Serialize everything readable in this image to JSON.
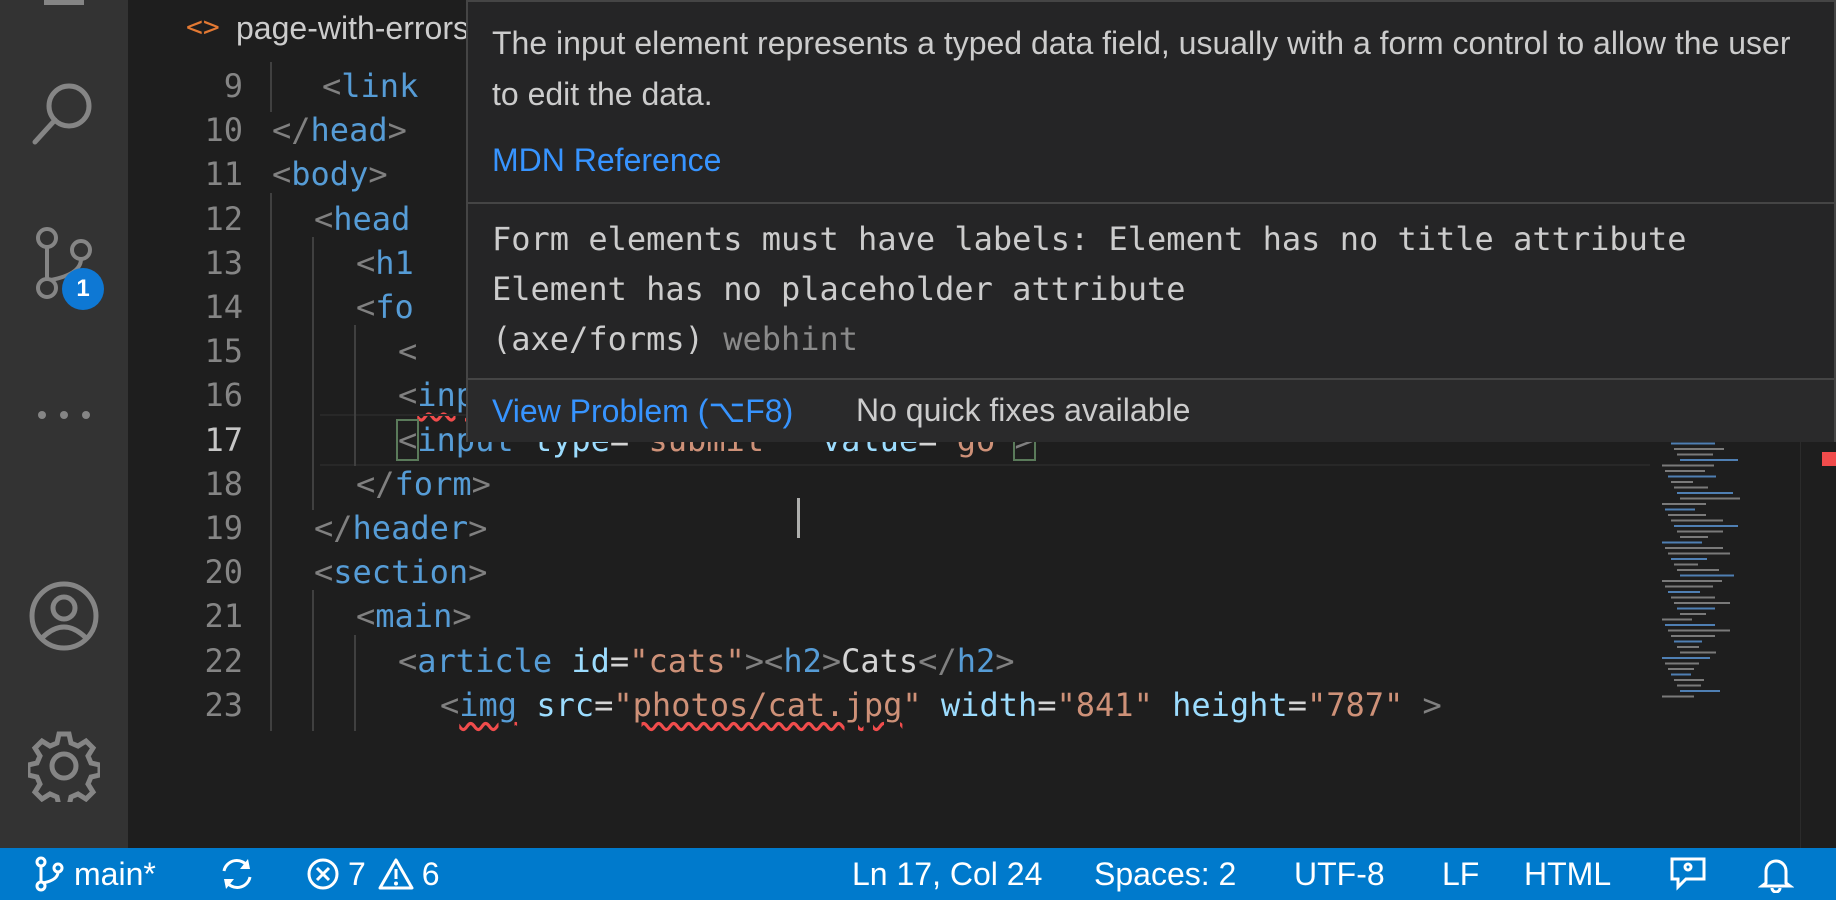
{
  "activity_bar": {
    "icons": [
      "menu-icon",
      "search-icon",
      "source-control-icon",
      "more-icon",
      "account-icon",
      "settings-gear-icon"
    ],
    "source_control_badge": "1"
  },
  "tab": {
    "label": "page-with-errors.html",
    "icon": "html-file-icon",
    "icon_glyph": "<>"
  },
  "editor": {
    "lines": [
      {
        "n": "9"
      },
      {
        "n": "10"
      },
      {
        "n": "11"
      },
      {
        "n": "12"
      },
      {
        "n": "13"
      },
      {
        "n": "14"
      },
      {
        "n": "15"
      },
      {
        "n": "16"
      },
      {
        "n": "17"
      },
      {
        "n": "18"
      },
      {
        "n": "19"
      },
      {
        "n": "20"
      },
      {
        "n": "21"
      },
      {
        "n": "22"
      },
      {
        "n": "23"
      }
    ]
  },
  "hover": {
    "description": "The input element represents a typed data field, usually with a form control to allow the user to edit the data.",
    "mdn_link": "MDN Reference",
    "problem_line1": "Form elements must have labels: Element has no title attribute",
    "problem_line2": "Element has no placeholder attribute",
    "problem_code": "(axe/forms)",
    "problem_source": "webhint",
    "view_problem": "View Problem (⌥F8)",
    "no_fixes": "No quick fixes available"
  },
  "status_bar": {
    "branch": "main*",
    "errors": "7",
    "warnings": "6",
    "position": "Ln 17, Col 24",
    "spaces": "Spaces: 2",
    "encoding": "UTF-8",
    "eol": "LF",
    "language": "HTML"
  },
  "colors": {
    "status_bar": "#007acc",
    "activity_bar": "#333333",
    "editor_bg": "#1e1e1e",
    "hover_bg": "#252526",
    "link": "#3794ff",
    "error": "#f14c4c",
    "tag": "#569cd6",
    "attribute": "#9cdcfe",
    "string": "#ce9178"
  }
}
